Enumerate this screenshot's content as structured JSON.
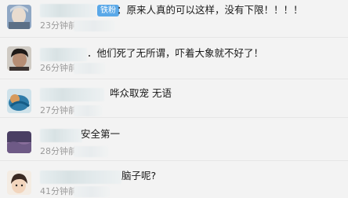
{
  "comments": [
    {
      "badge": "铁粉",
      "text": "：原来人真的可以这样，没有下限！！！！",
      "time": "23分钟前"
    },
    {
      "text": "．他们死了无所谓，吓着大象就不好了！",
      "time": "26分钟前"
    },
    {
      "text": "哗众取宠 无语",
      "time": "27分钟前"
    },
    {
      "text": "安全第一",
      "time": "28分钟前"
    },
    {
      "text": "脑子呢?",
      "time": "41分钟前"
    }
  ]
}
